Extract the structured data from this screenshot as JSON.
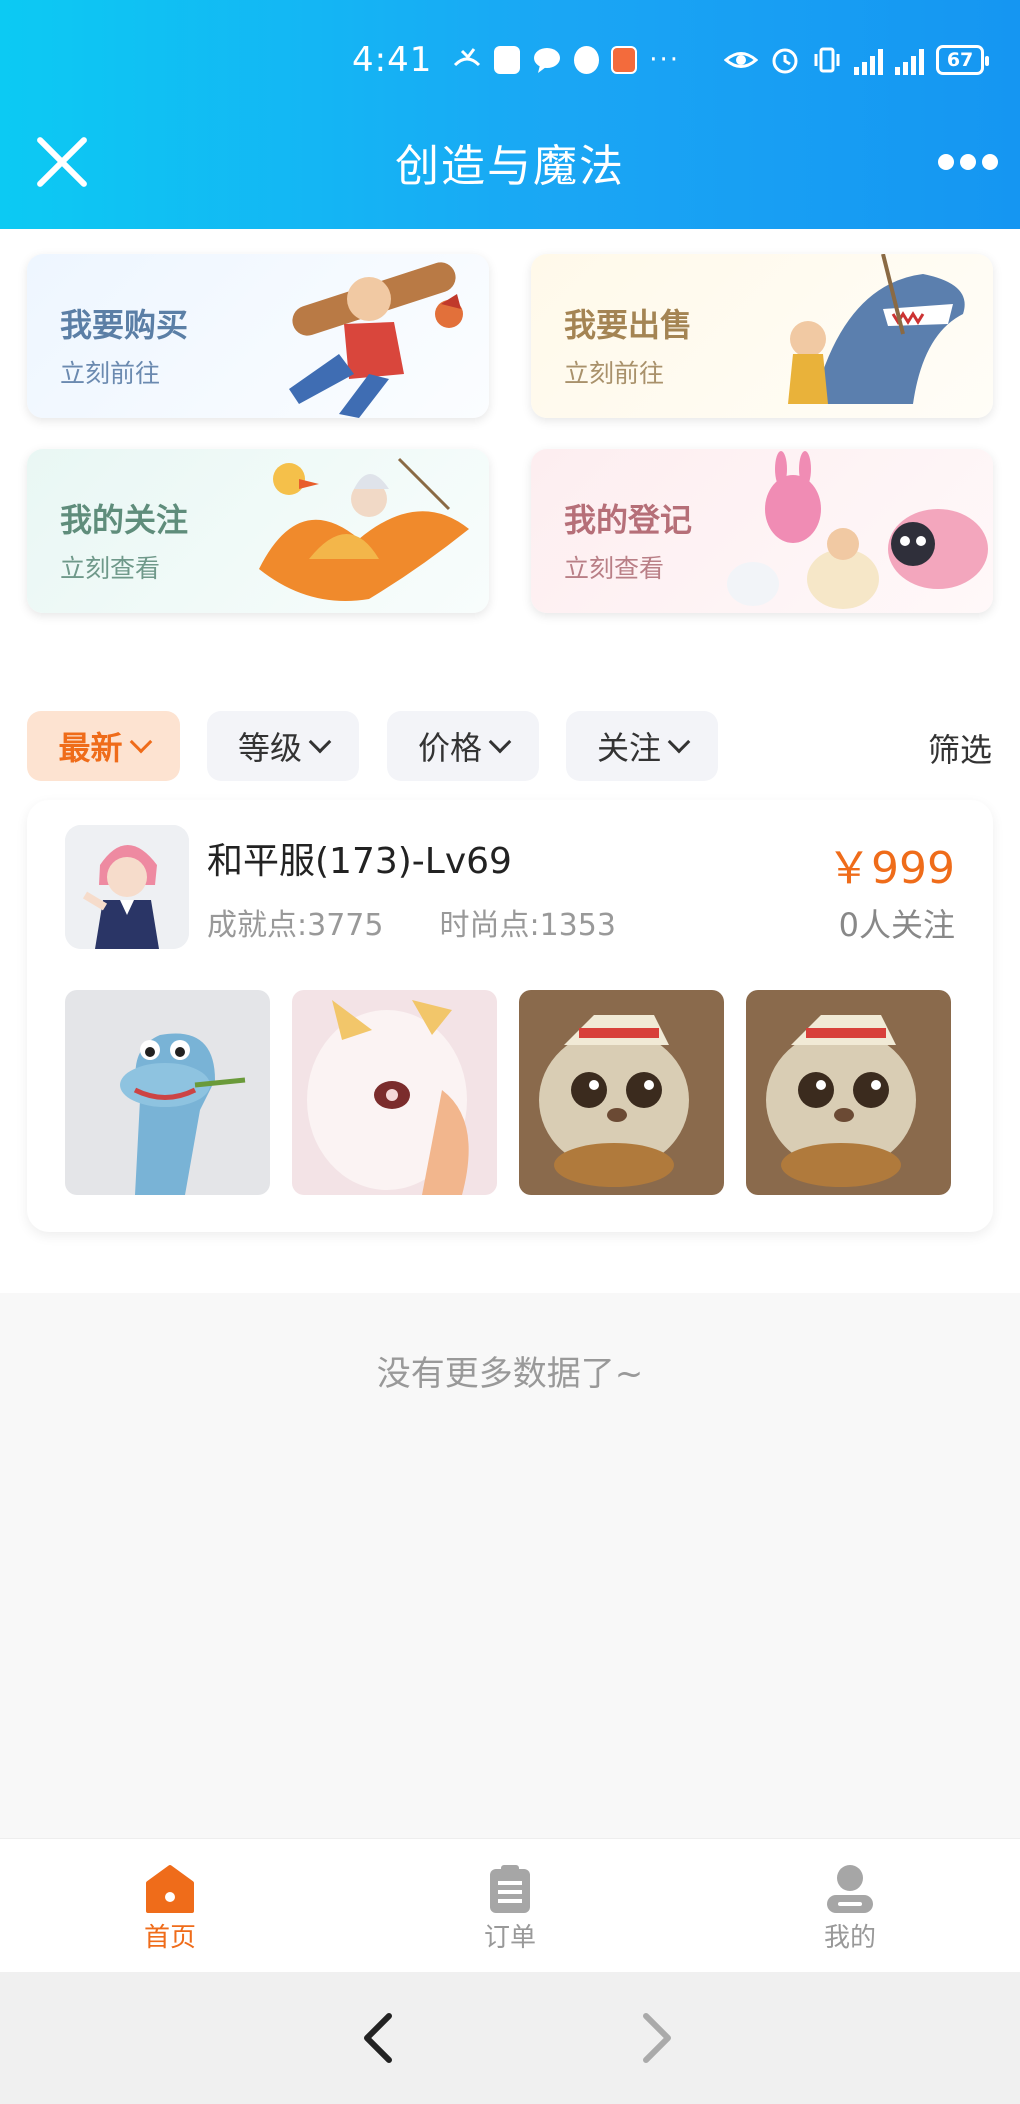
{
  "status_bar": {
    "time": "4:41",
    "battery": "67",
    "icons": [
      "missed-call-icon",
      "app-notification-icon",
      "message-icon",
      "browser-icon",
      "app-icon",
      "more-notifications-icon",
      "eye-icon",
      "alarm-icon",
      "vibrate-icon",
      "signal-4g-icon",
      "signal-5g-icon",
      "battery-icon"
    ],
    "more_dots": "···"
  },
  "header": {
    "title": "创造与魔法",
    "bg_colors": [
      "#0ccaf3",
      "#1596f2"
    ]
  },
  "quick_cards": [
    {
      "title": "我要购买",
      "subtitle": "立刻前往"
    },
    {
      "title": "我要出售",
      "subtitle": "立刻前往"
    },
    {
      "title": "我的关注",
      "subtitle": "立刻查看"
    },
    {
      "title": "我的登记",
      "subtitle": "立刻查看"
    }
  ],
  "filters": {
    "chips": [
      {
        "label": "最新",
        "active": true
      },
      {
        "label": "等级",
        "active": false
      },
      {
        "label": "价格",
        "active": false
      },
      {
        "label": "关注",
        "active": false
      }
    ],
    "filter_label": "筛选"
  },
  "listing": {
    "name": "和平服(173)-Lv69",
    "achievement": "成就点:3775",
    "fashion": "时尚点:1353",
    "price": "￥999",
    "follows": "0人关注",
    "pets": [
      "blue-dragon-pet",
      "white-rabbit-pet",
      "squirrel-pet",
      "squirrel-pet"
    ]
  },
  "no_more": "没有更多数据了~",
  "tabbar": {
    "home": "首页",
    "orders": "订单",
    "mine": "我的"
  },
  "colors": {
    "accent": "#ef6c1a",
    "price": "#ef6c1a"
  }
}
